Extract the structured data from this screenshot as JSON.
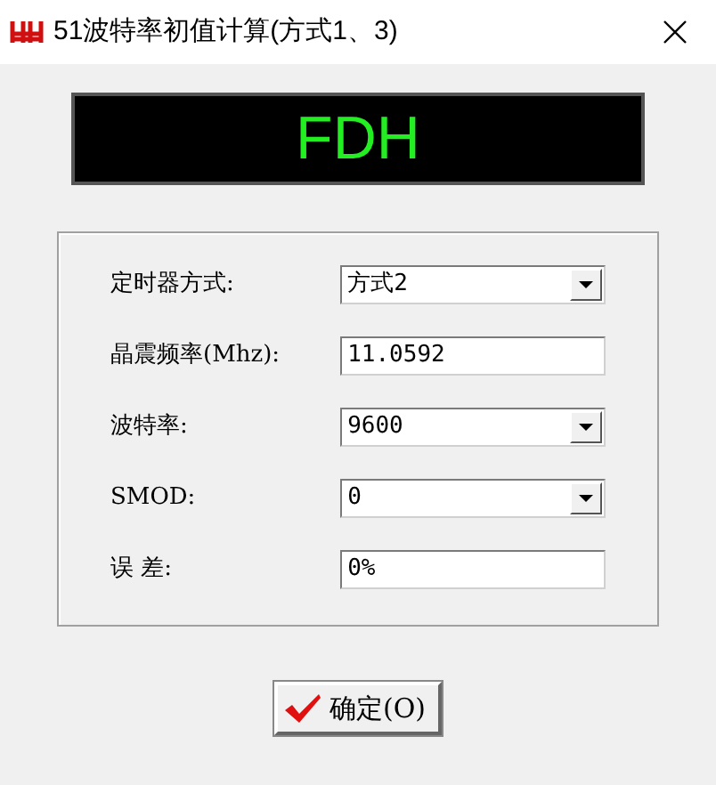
{
  "window": {
    "title": "51波特率初值计算(方式1、3)"
  },
  "display": {
    "value": "FDH"
  },
  "fields": [
    {
      "label": "定时器方式:",
      "kind": "select",
      "value": "方式2"
    },
    {
      "label": "晶震频率(Mhz):",
      "kind": "text",
      "value": "11.0592"
    },
    {
      "label": "波特率:",
      "kind": "select",
      "value": "9600"
    },
    {
      "label": "SMOD:",
      "kind": "select",
      "value": "0"
    },
    {
      "label": "误 差:",
      "kind": "text",
      "value": "0%"
    }
  ],
  "buttons": [
    {
      "label": "确定(O)"
    }
  ]
}
